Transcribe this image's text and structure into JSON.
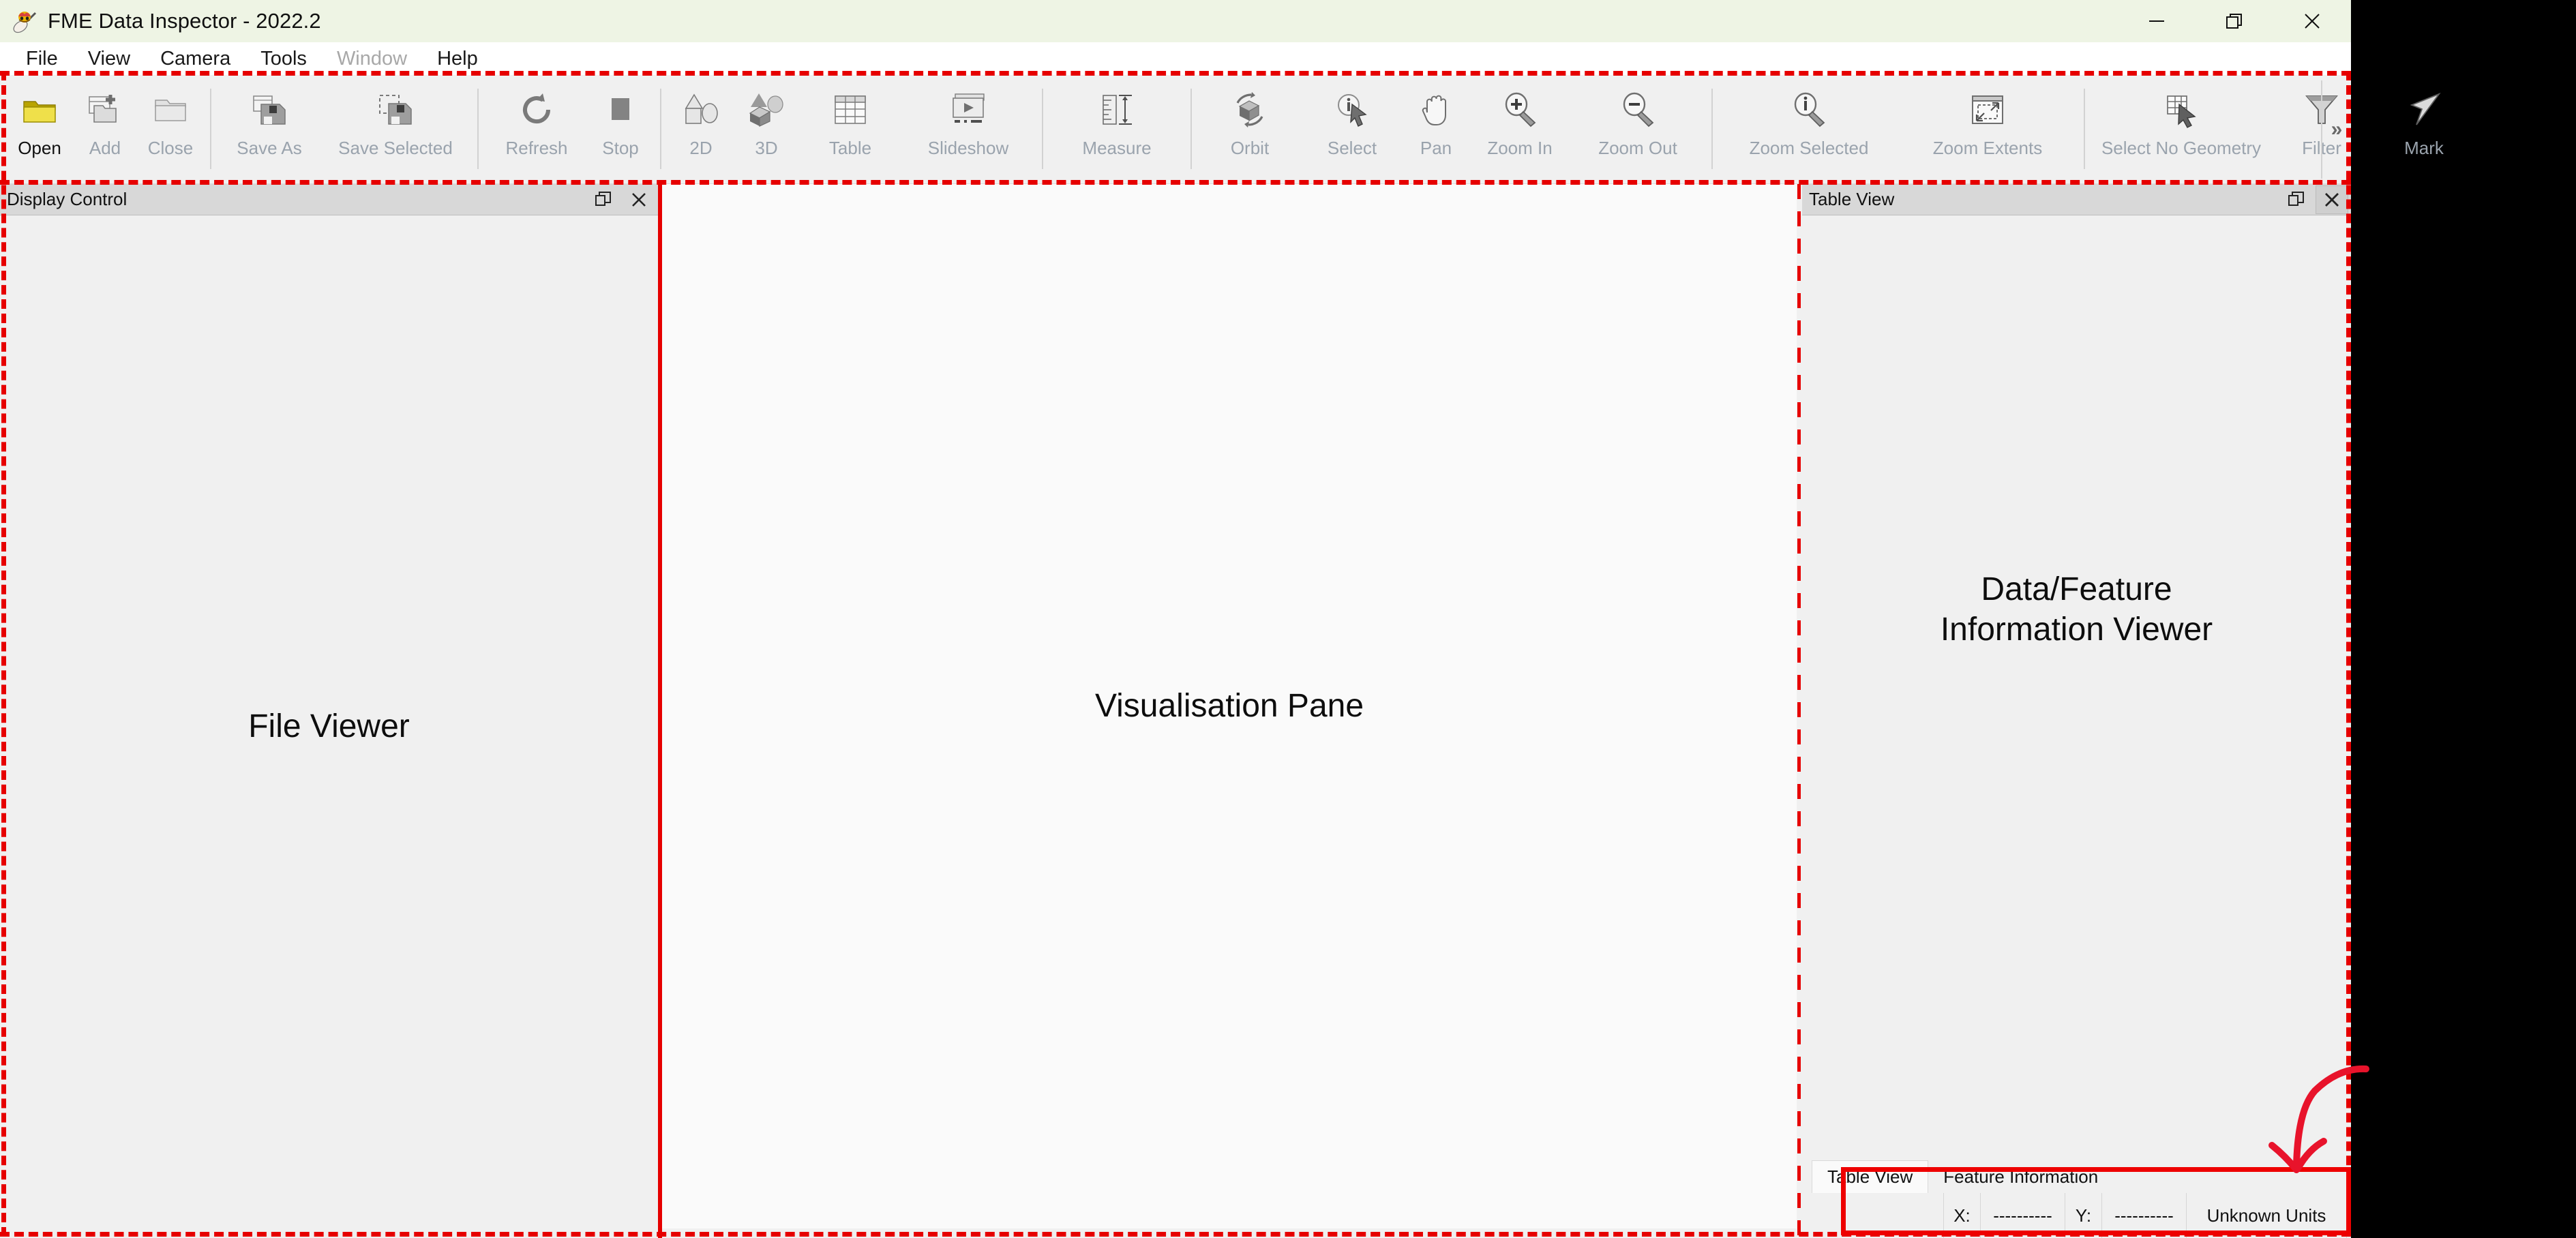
{
  "window": {
    "title": "FME Data Inspector - 2022.2",
    "app_icon": "fme-bee-icon",
    "controls": [
      {
        "name": "minimize",
        "glyph": "minimize-icon"
      },
      {
        "name": "restore",
        "glyph": "restore-icon"
      },
      {
        "name": "close",
        "glyph": "close-icon"
      }
    ]
  },
  "menubar": {
    "items": [
      {
        "label": "File",
        "enabled": true
      },
      {
        "label": "View",
        "enabled": true
      },
      {
        "label": "Camera",
        "enabled": true
      },
      {
        "label": "Tools",
        "enabled": true
      },
      {
        "label": "Window",
        "enabled": false
      },
      {
        "label": "Help",
        "enabled": true
      }
    ]
  },
  "toolbar": {
    "overflow_label": "»",
    "buttons": [
      {
        "label": "Open",
        "icon": "open-folder-icon",
        "enabled": true
      },
      {
        "label": "Add",
        "icon": "add-dataset-icon",
        "enabled": false
      },
      {
        "label": "Close",
        "icon": "close-folder-icon",
        "enabled": false
      },
      {
        "label": "Save As",
        "icon": "save-as-icon",
        "enabled": false
      },
      {
        "label": "Save Selected",
        "icon": "save-selected-icon",
        "enabled": false
      },
      {
        "label": "Refresh",
        "icon": "refresh-icon",
        "enabled": false
      },
      {
        "label": "Stop",
        "icon": "stop-icon",
        "enabled": false
      },
      {
        "label": "2D",
        "icon": "view-2d-icon",
        "enabled": false
      },
      {
        "label": "3D",
        "icon": "view-3d-icon",
        "enabled": false
      },
      {
        "label": "Table",
        "icon": "table-icon",
        "enabled": false
      },
      {
        "label": "Slideshow",
        "icon": "slideshow-icon",
        "enabled": false
      },
      {
        "label": "Measure",
        "icon": "measure-ruler-icon",
        "enabled": false
      },
      {
        "label": "Orbit",
        "icon": "orbit-icon",
        "enabled": false
      },
      {
        "label": "Select",
        "icon": "select-info-cursor-icon",
        "enabled": false
      },
      {
        "label": "Pan",
        "icon": "pan-hand-icon",
        "enabled": false
      },
      {
        "label": "Zoom In",
        "icon": "zoom-in-icon",
        "enabled": false
      },
      {
        "label": "Zoom Out",
        "icon": "zoom-out-icon",
        "enabled": false
      },
      {
        "label": "Zoom Selected",
        "icon": "zoom-selected-icon",
        "enabled": false
      },
      {
        "label": "Zoom Extents",
        "icon": "zoom-extents-icon",
        "enabled": false
      },
      {
        "label": "Select No Geometry",
        "icon": "select-no-geometry-icon",
        "enabled": false
      },
      {
        "label": "Filter",
        "icon": "filter-funnel-icon",
        "enabled": false
      },
      {
        "label": "Mark",
        "icon": "mark-arrow-icon",
        "enabled": false
      }
    ]
  },
  "left_panel": {
    "title": "Display Control",
    "float_button": "float-icon",
    "close_button": "close-icon",
    "annotation": "File Viewer"
  },
  "center_pane": {
    "annotation": "Visualisation Pane"
  },
  "right_panel": {
    "title": "Table View",
    "float_button": "float-icon",
    "close_button": "close-icon",
    "annotation_line1": "Data/Feature",
    "annotation_line2": "Information Viewer",
    "tabs": [
      {
        "label": "Table View",
        "active": true
      },
      {
        "label": "Feature Information",
        "active": false
      }
    ],
    "statusbar": {
      "x_label": "X:",
      "x_value": "----------",
      "y_label": "Y:",
      "y_value": "----------",
      "units": "Unknown Units"
    }
  },
  "annotations": {
    "highlight_color": "#ee0000",
    "dashed_color": "#e60000",
    "arrow": "curved-arrow-pointing-to-status-bar"
  }
}
